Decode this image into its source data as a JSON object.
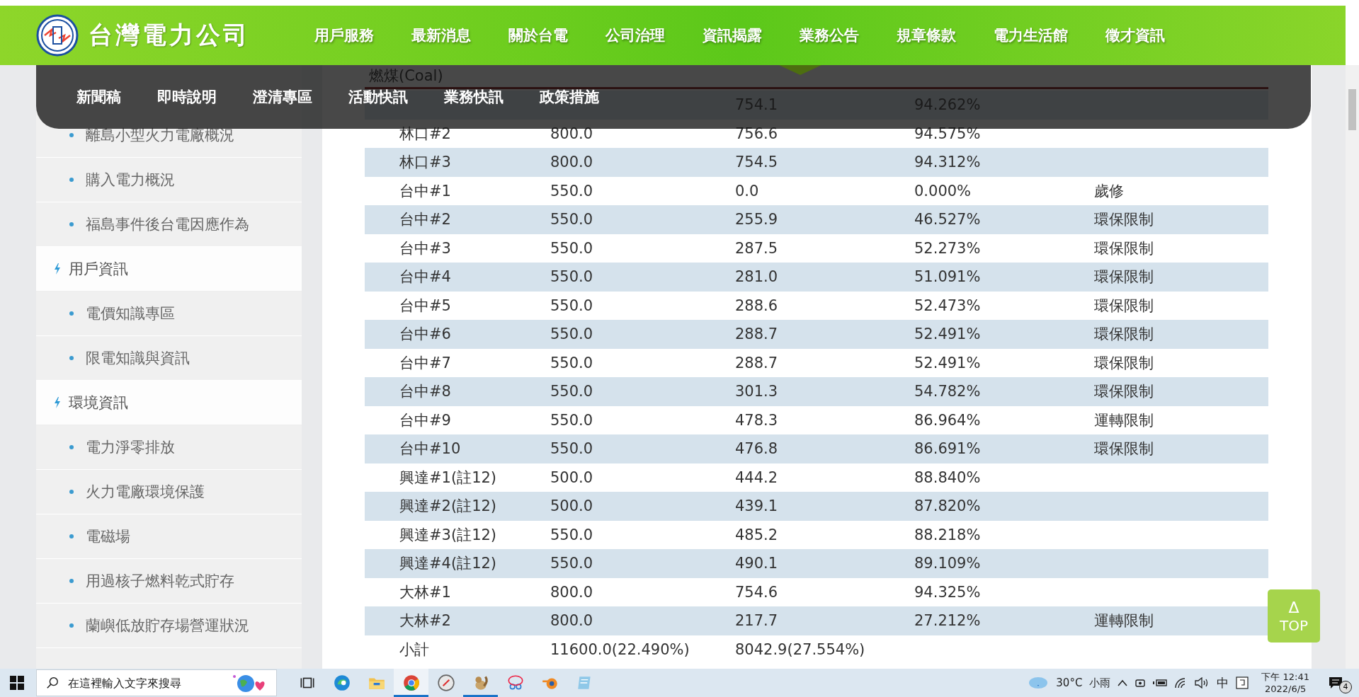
{
  "header": {
    "logo_text": "台灣電力公司",
    "nav": [
      "用戶服務",
      "最新消息",
      "關於台電",
      "公司治理",
      "資訊揭露",
      "業務公告",
      "規章條款",
      "電力生活館",
      "徵才資訊"
    ],
    "submenu": [
      "新聞稿",
      "即時說明",
      "澄清專區",
      "活動快訊",
      "業務快訊",
      "政策措施"
    ]
  },
  "sidebar": {
    "items": [
      {
        "kind": "link",
        "label": "離島小型火力電廠概況"
      },
      {
        "kind": "link",
        "label": "購入電力概況"
      },
      {
        "kind": "link",
        "label": "福島事件後台電因應作為"
      },
      {
        "kind": "heading",
        "label": "用戶資訊"
      },
      {
        "kind": "link",
        "label": "電價知識專區"
      },
      {
        "kind": "link",
        "label": "限電知識與資訊"
      },
      {
        "kind": "heading",
        "label": "環境資訊"
      },
      {
        "kind": "link",
        "label": "電力淨零排放"
      },
      {
        "kind": "link",
        "label": "火力電廠環境保護"
      },
      {
        "kind": "link",
        "label": "電磁場"
      },
      {
        "kind": "link",
        "label": "用過核子燃料乾式貯存"
      },
      {
        "kind": "link",
        "label": "蘭嶼低放貯存場營運狀況"
      }
    ]
  },
  "table": {
    "section_title": "燃煤(Coal)",
    "rows": [
      [
        null,
        null,
        "754.1",
        "94.262%"
      ],
      [
        "林口#2",
        "800.0",
        "756.6",
        "94.575%"
      ],
      [
        "林口#3",
        "800.0",
        "754.5",
        "94.312%"
      ],
      [
        "台中#1",
        "550.0",
        "0.0",
        "0.000%",
        "歲修"
      ],
      [
        "台中#2",
        "550.0",
        "255.9",
        "46.527%",
        "環保限制"
      ],
      [
        "台中#3",
        "550.0",
        "287.5",
        "52.273%",
        "環保限制"
      ],
      [
        "台中#4",
        "550.0",
        "281.0",
        "51.091%",
        "環保限制"
      ],
      [
        "台中#5",
        "550.0",
        "288.6",
        "52.473%",
        "環保限制"
      ],
      [
        "台中#6",
        "550.0",
        "288.7",
        "52.491%",
        "環保限制"
      ],
      [
        "台中#7",
        "550.0",
        "288.7",
        "52.491%",
        "環保限制"
      ],
      [
        "台中#8",
        "550.0",
        "301.3",
        "54.782%",
        "環保限制"
      ],
      [
        "台中#9",
        "550.0",
        "478.3",
        "86.964%",
        "運轉限制"
      ],
      [
        "台中#10",
        "550.0",
        "476.8",
        "86.691%",
        "環保限制"
      ],
      [
        "興達#1(註12)",
        "500.0",
        "444.2",
        "88.840%"
      ],
      [
        "興達#2(註12)",
        "500.0",
        "439.1",
        "87.820%"
      ],
      [
        "興達#3(註12)",
        "550.0",
        "485.2",
        "88.218%"
      ],
      [
        "興達#4(註12)",
        "550.0",
        "490.1",
        "89.109%"
      ],
      [
        "大林#1",
        "800.0",
        "754.6",
        "94.325%"
      ],
      [
        "大林#2",
        "800.0",
        "217.7",
        "27.212%",
        "運轉限制"
      ],
      [
        "小計",
        "11600.0(22.490%)",
        "8042.9(27.554%)"
      ]
    ]
  },
  "top_button": {
    "symbol": "Δ",
    "label": "TOP"
  },
  "taskbar": {
    "search_placeholder": "在這裡輸入文字來搜尋",
    "apps": [
      {
        "kind": "taskview",
        "open": false
      },
      {
        "kind": "edge",
        "open": false
      },
      {
        "kind": "folder",
        "open": false
      },
      {
        "kind": "chrome",
        "open": true
      },
      {
        "kind": "compass",
        "open": false
      },
      {
        "kind": "squirrel",
        "open": true
      },
      {
        "kind": "snip",
        "open": false
      },
      {
        "kind": "blender",
        "open": false
      },
      {
        "kind": "notepad",
        "open": false
      }
    ],
    "weather": {
      "temperature": "30°C",
      "condition": "小雨"
    },
    "ime": "中",
    "time": "下午 12:41",
    "date": "2022/6/5",
    "notifications": "4"
  }
}
